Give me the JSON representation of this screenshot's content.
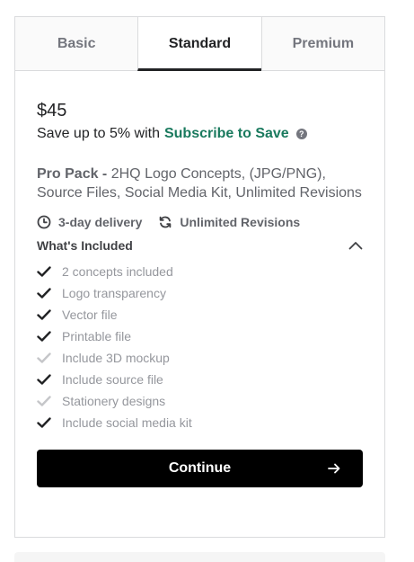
{
  "tabs": [
    {
      "label": "Basic",
      "active": false
    },
    {
      "label": "Standard",
      "active": true
    },
    {
      "label": "Premium",
      "active": false
    }
  ],
  "price": "$45",
  "subscribe": {
    "prefix": "Save up to 5% with",
    "link": "Subscribe to Save",
    "help_icon": "question-circle-icon"
  },
  "package": {
    "name": "Pro Pack -",
    "description": "2HQ Logo Concepts, (JPG/PNG), Source Files, Social Media Kit, Unlimited Revisions"
  },
  "meta": {
    "delivery": "3-day delivery",
    "delivery_icon": "clock-icon",
    "revisions": "Unlimited Revisions",
    "revisions_icon": "refresh-icon"
  },
  "included": {
    "title": "What's Included",
    "toggle_icon": "chevron-up-icon",
    "features": [
      {
        "label": "2 concepts included",
        "included": true
      },
      {
        "label": "Logo transparency",
        "included": true
      },
      {
        "label": "Vector file",
        "included": true
      },
      {
        "label": "Printable file",
        "included": true
      },
      {
        "label": "Include 3D mockup",
        "included": false
      },
      {
        "label": "Include source file",
        "included": true
      },
      {
        "label": "Stationery designs",
        "included": false
      },
      {
        "label": "Include social media kit",
        "included": true
      }
    ]
  },
  "continue": {
    "label": "Continue",
    "icon": "arrow-right-icon"
  },
  "colors": {
    "accent_link": "#1a7a5e",
    "check_on": "#222325",
    "check_off": "#c5c6c9",
    "button_bg": "#000000"
  }
}
